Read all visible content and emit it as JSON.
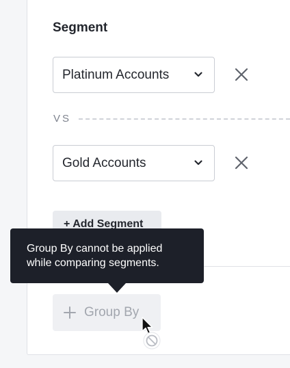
{
  "segment": {
    "title": "Segment",
    "selects": [
      {
        "label": "Platinum Accounts"
      },
      {
        "label": "Gold Accounts"
      }
    ],
    "vs_label": "VS",
    "add_segment_label": "+ Add Segment"
  },
  "group_by": {
    "label": "Group By",
    "disabled": true
  },
  "tooltip": {
    "line1": "Group By cannot be applied",
    "line2": "while comparing segments."
  },
  "icons": {
    "chevron": "chevron-down-icon",
    "remove": "close-icon",
    "plus": "plus-icon",
    "cursor": "arrow-pointer-icon",
    "not_allowed": "not-allowed-icon"
  },
  "colors": {
    "tooltip_bg": "#1d2029",
    "disabled_text": "#a2a6ae",
    "button_bg": "#e9ebef"
  }
}
